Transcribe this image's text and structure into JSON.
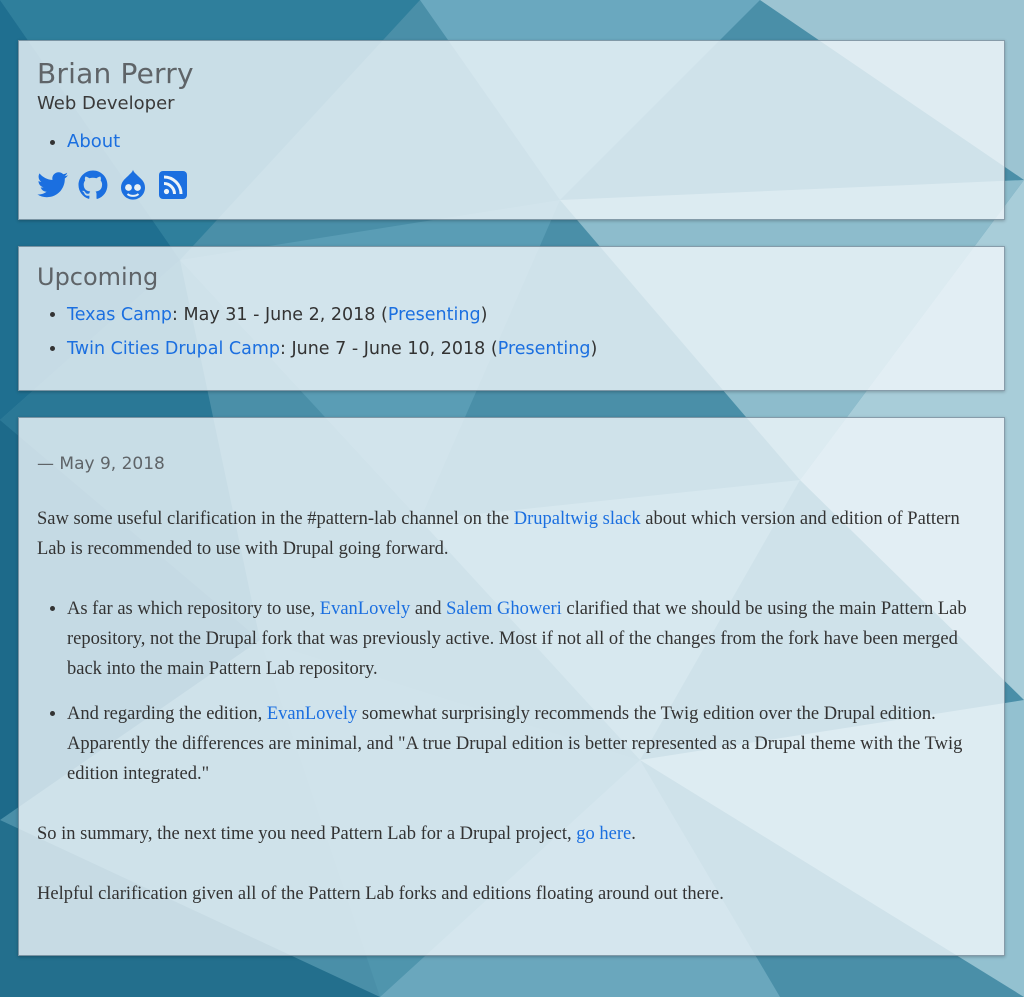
{
  "site": {
    "name": "Brian Perry",
    "slogan": "Web Developer",
    "menu": [
      {
        "label": "About"
      }
    ],
    "social": [
      "twitter-icon",
      "github-icon",
      "drupal-icon",
      "rss-icon"
    ],
    "link_color": "#1b6fe0"
  },
  "upcoming": {
    "title": "Upcoming",
    "events": [
      {
        "name": "Texas Camp",
        "dates": ": May 31 - June 2, 2018 (",
        "role": "Presenting",
        "close": ")"
      },
      {
        "name": "Twin Cities Drupal Camp",
        "dates": ": June 7 - June 10, 2018 (",
        "role": "Presenting",
        "close": ")"
      }
    ]
  },
  "post": {
    "date": "— May 9, 2018",
    "intro": {
      "a": "Saw some useful clarification in the #pattern-lab channel on the ",
      "link": "Drupaltwig slack",
      "b": " about which version and edition of Pattern Lab is recommended to use with Drupal going forward."
    },
    "bullet1": {
      "a": "As far as which repository to use, ",
      "link1": "EvanLovely",
      "b": " and ",
      "link2": "Salem Ghoweri",
      "c": " clarified that we should be using the main Pattern Lab repository, not the Drupal fork that was previously active. Most if not all of the changes from the fork have been merged back into the main Pattern Lab repository."
    },
    "bullet2": {
      "a": "And regarding the edition, ",
      "link": "EvanLovely",
      "b": " somewhat surprisingly recommends the Twig edition over the Drupal edition. Apparently the differences are minimal, and \"A true Drupal edition is better represented as a Drupal theme with the Twig edition integrated.\""
    },
    "summary": {
      "a": "So in summary, the next time you need Pattern Lab for a Drupal project, ",
      "link": "go here",
      "b": "."
    },
    "closing": "Helpful clarification given all of the Pattern Lab forks and editions floating around out there."
  }
}
